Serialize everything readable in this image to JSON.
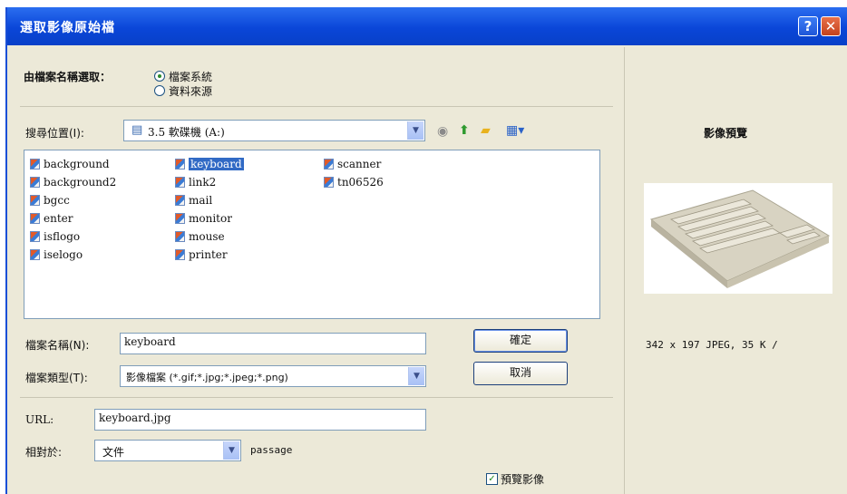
{
  "window": {
    "title": "選取影像原始檔",
    "help_glyph": "?",
    "close_glyph": "✕"
  },
  "source": {
    "label": "由檔案名稱選取：",
    "options": [
      {
        "label": "檔案系統",
        "selected": true
      },
      {
        "label": "資料來源",
        "selected": false
      }
    ]
  },
  "look_in": {
    "label": "搜尋位置(I):",
    "value": "3.5 軟碟機 (A:)",
    "drive_icon": "floppy-drive-icon"
  },
  "toolbar": {
    "icons": [
      "back-icon",
      "up-folder-icon",
      "new-folder-icon",
      "view-menu-icon"
    ]
  },
  "files": [
    {
      "name": "background",
      "selected": false
    },
    {
      "name": "background2",
      "selected": false
    },
    {
      "name": "bgcc",
      "selected": false
    },
    {
      "name": "enter",
      "selected": false
    },
    {
      "name": "isflogo",
      "selected": false
    },
    {
      "name": "iselogo",
      "selected": false
    },
    {
      "name": "keyboard",
      "selected": true
    },
    {
      "name": "link2",
      "selected": false
    },
    {
      "name": "mail",
      "selected": false
    },
    {
      "name": "monitor",
      "selected": false
    },
    {
      "name": "mouse",
      "selected": false
    },
    {
      "name": "printer",
      "selected": false
    },
    {
      "name": "scanner",
      "selected": false
    },
    {
      "name": "tn06526",
      "selected": false
    }
  ],
  "filename": {
    "label": "檔案名稱(N):",
    "value": "keyboard"
  },
  "filetype": {
    "label": "檔案類型(T):",
    "value": "影像檔案 (*.gif;*.jpg;*.jpeg;*.png)"
  },
  "buttons": {
    "ok": "確定",
    "cancel": "取消"
  },
  "url": {
    "label": "URL:",
    "value": "keyboard.jpg"
  },
  "relative": {
    "label": "相對於:",
    "value": "文件",
    "note": "passage"
  },
  "preview": {
    "title": "影像預覽",
    "info": "342 x 197 JPEG, 35 K /",
    "checkbox_label": "預覽影像",
    "checkbox_checked": true
  },
  "colors": {
    "titlebar": "#0a46d8",
    "dialog_bg": "#ece9d8",
    "selection": "#316ac5"
  }
}
